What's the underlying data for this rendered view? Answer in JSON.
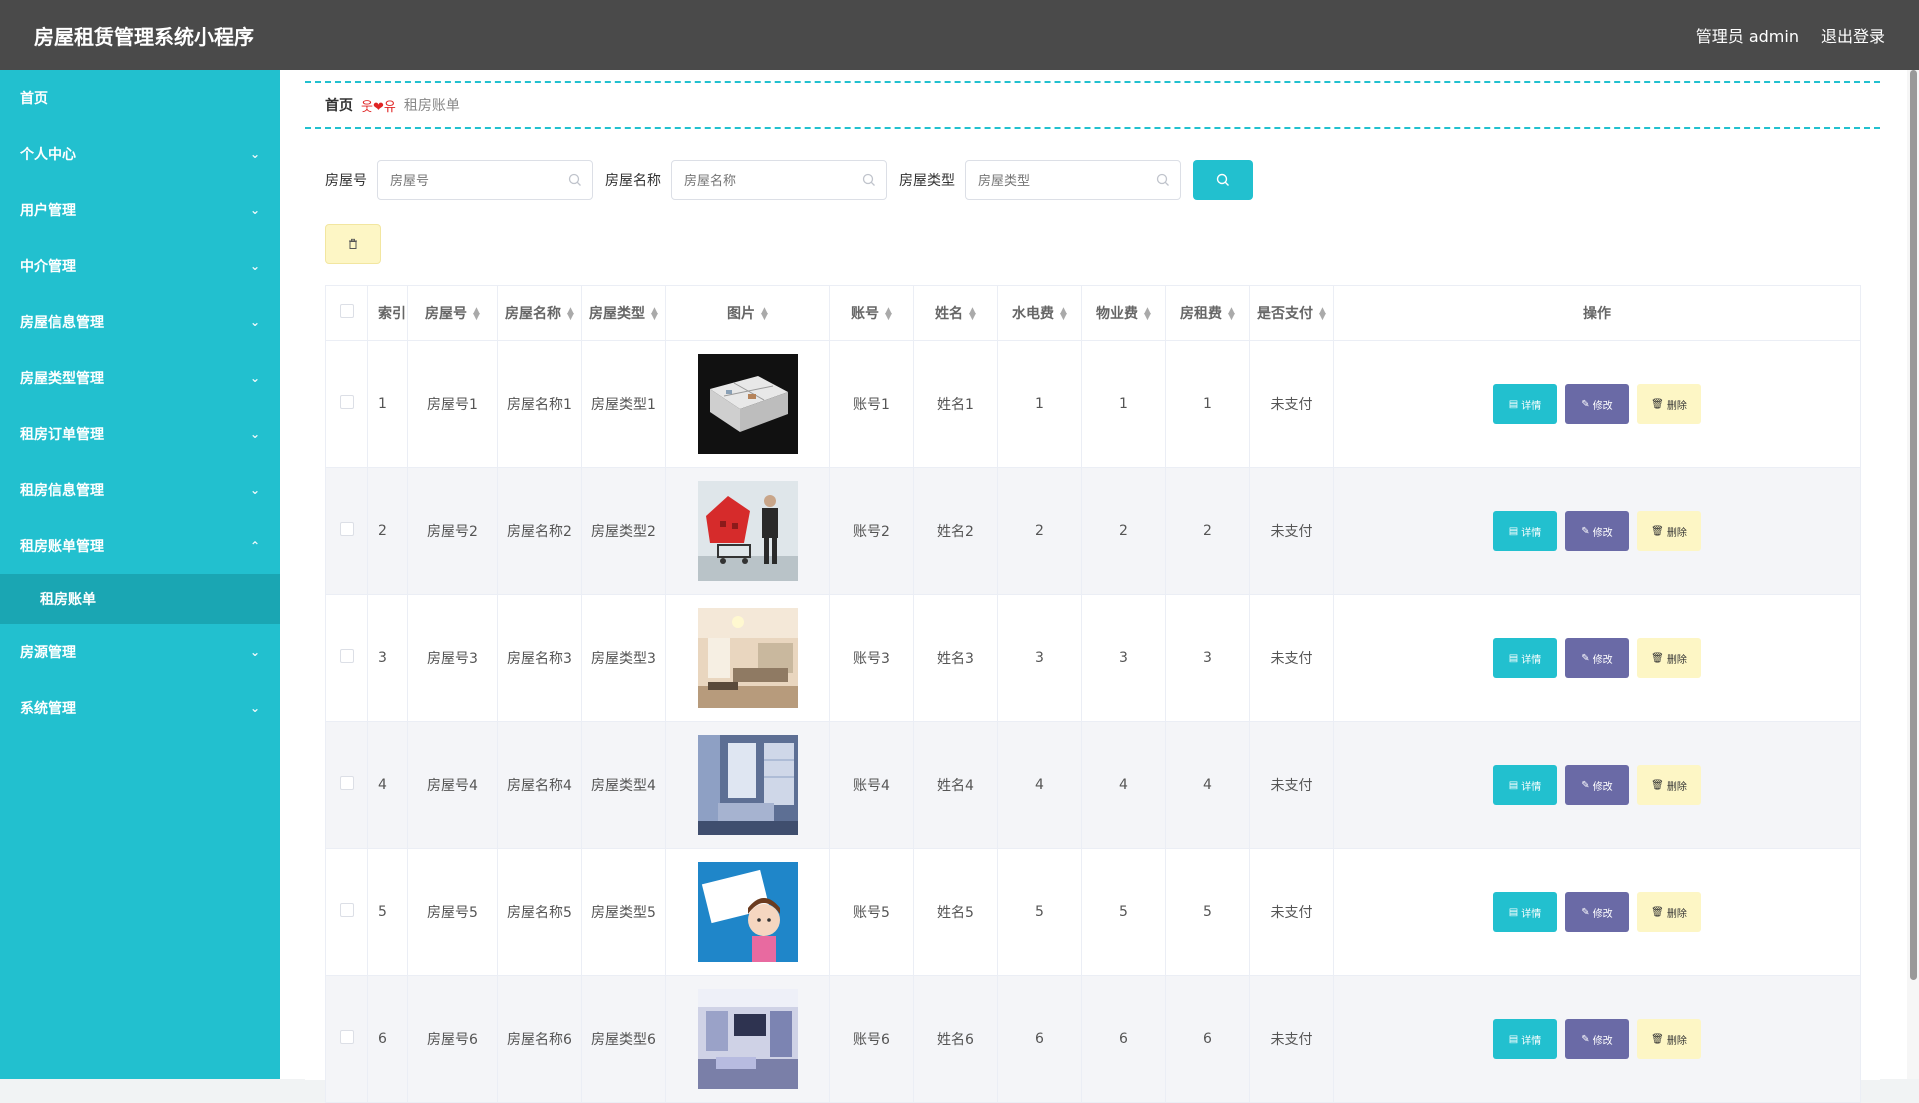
{
  "header": {
    "title": "房屋租赁管理系统小程序",
    "user": "管理员 admin",
    "logout": "退出登录"
  },
  "sidebar": {
    "items": [
      {
        "label": "首页"
      },
      {
        "label": "个人中心"
      },
      {
        "label": "用户管理"
      },
      {
        "label": "中介管理"
      },
      {
        "label": "房屋信息管理"
      },
      {
        "label": "房屋类型管理"
      },
      {
        "label": "租房订单管理"
      },
      {
        "label": "租房信息管理"
      },
      {
        "label": "租房账单管理"
      },
      {
        "label": "房源管理"
      },
      {
        "label": "系统管理"
      }
    ],
    "submenu": {
      "label": "租房账单"
    }
  },
  "breadcrumb": {
    "home": "首页",
    "separator": "웃❤유",
    "current": "租房账单"
  },
  "search": {
    "fields": [
      {
        "label": "房屋号",
        "placeholder": "房屋号"
      },
      {
        "label": "房屋名称",
        "placeholder": "房屋名称"
      },
      {
        "label": "房屋类型",
        "placeholder": "房屋类型"
      }
    ]
  },
  "table": {
    "headers": [
      "索引",
      "房屋号",
      "房屋名称",
      "房屋类型",
      "图片",
      "账号",
      "姓名",
      "水电费",
      "物业费",
      "房租费",
      "是否支付",
      "操作"
    ],
    "rows": [
      {
        "index": "1",
        "house_no": "房屋号1",
        "house_name": "房屋名称1",
        "house_type": "房屋类型1",
        "account": "账号1",
        "name": "姓名1",
        "utility": "1",
        "property": "1",
        "rent": "1",
        "paid": "未支付"
      },
      {
        "index": "2",
        "house_no": "房屋号2",
        "house_name": "房屋名称2",
        "house_type": "房屋类型2",
        "account": "账号2",
        "name": "姓名2",
        "utility": "2",
        "property": "2",
        "rent": "2",
        "paid": "未支付"
      },
      {
        "index": "3",
        "house_no": "房屋号3",
        "house_name": "房屋名称3",
        "house_type": "房屋类型3",
        "account": "账号3",
        "name": "姓名3",
        "utility": "3",
        "property": "3",
        "rent": "3",
        "paid": "未支付"
      },
      {
        "index": "4",
        "house_no": "房屋号4",
        "house_name": "房屋名称4",
        "house_type": "房屋类型4",
        "account": "账号4",
        "name": "姓名4",
        "utility": "4",
        "property": "4",
        "rent": "4",
        "paid": "未支付"
      },
      {
        "index": "5",
        "house_no": "房屋号5",
        "house_name": "房屋名称5",
        "house_type": "房屋类型5",
        "account": "账号5",
        "name": "姓名5",
        "utility": "5",
        "property": "5",
        "rent": "5",
        "paid": "未支付"
      },
      {
        "index": "6",
        "house_no": "房屋号6",
        "house_name": "房屋名称6",
        "house_type": "房屋类型6",
        "account": "账号6",
        "name": "姓名6",
        "utility": "6",
        "property": "6",
        "rent": "6",
        "paid": "未支付"
      }
    ],
    "ops": {
      "detail": "详情",
      "edit": "修改",
      "delete": "删除"
    }
  },
  "colors": {
    "primary": "#22c0cf",
    "header_bg": "#4a4a4a",
    "edit": "#6a6aa6",
    "delete": "#fdf6c5",
    "active_submenu": "#1aa6b3"
  }
}
